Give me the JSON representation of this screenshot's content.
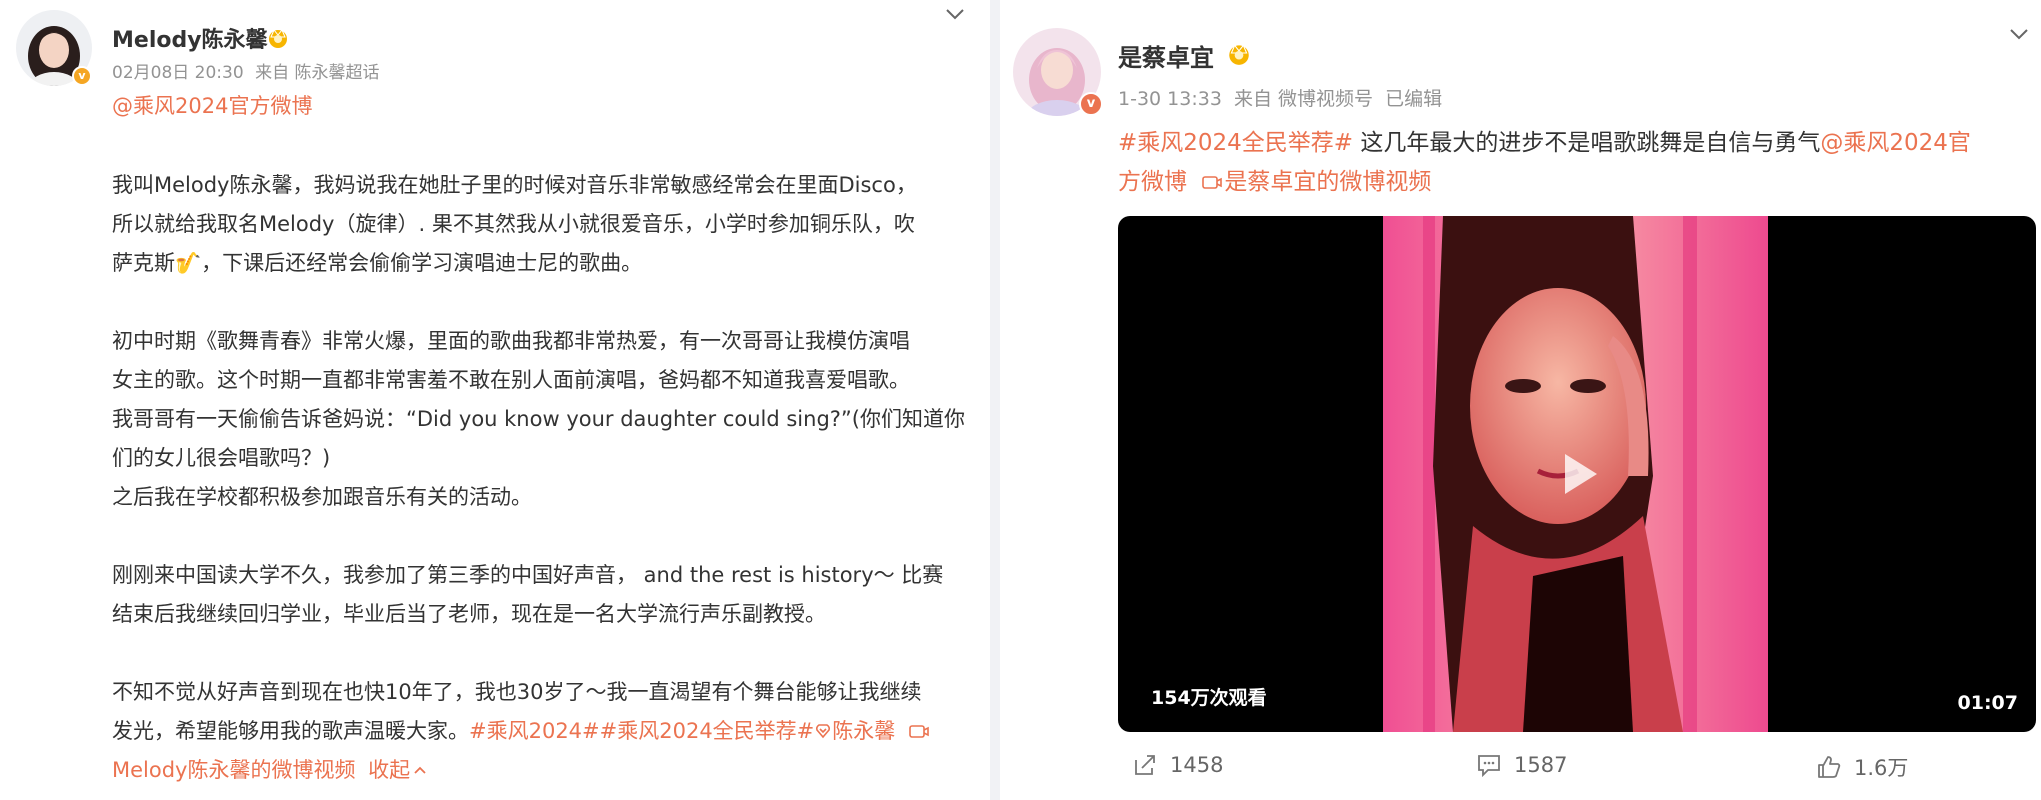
{
  "left_post": {
    "username": "Melody陈永馨",
    "timestamp": "02月08日 20:30",
    "source": "来自 陈永馨超话",
    "mention_line": "@乘风2024官方微博",
    "paragraphs": [
      [
        "我叫Melody陈永馨，我妈说我在她肚子里的时候对音乐非常敏感经常会在里面Disco，",
        "所以就给我取名Melody（旋律）. 果不其然我从小就很爱音乐，小学时参加铜乐队，吹",
        "萨克斯🎷，下课后还经常会偷偷学习演唱迪士尼的歌曲。"
      ],
      [
        "初中时期《歌舞青春》非常火爆，里面的歌曲我都非常热爱，有一次哥哥让我模仿演唱",
        "女主的歌。这个时期一直都非常害羞不敢在别人面前演唱，爸妈都不知道我喜爱唱歌。",
        "我哥哥有一天偷偷告诉爸妈说：“Did you know your daughter could sing?”(你们知道你",
        "们的女儿很会唱歌吗？)",
        "之后我在学校都积极参加跟音乐有关的活动。"
      ],
      [
        "刚刚来中国读大学不久，我参加了第三季的中国好声音， and the rest is history～ 比赛",
        "结束后我继续回归学业，毕业后当了老师，现在是一名大学流行声乐副教授。"
      ]
    ],
    "last_line_1": "不知不觉从好声音到现在也快10年了，我也30岁了～我一直渴望有个舞台能够让我继续",
    "last_line_2_plain": "发光，希望能够用我的歌声温暖大家。",
    "hashtags": "#乘风2024##乘风2024全民举荐#",
    "super_topic": "陈永馨",
    "video_link": "Melody陈永馨的微博视频",
    "collapse_label": "收起"
  },
  "right_post": {
    "username": "是蔡卓宜",
    "timestamp": "1-30 13:33",
    "source": "来自 微博视频号",
    "edited": "已编辑",
    "hashtag": "#乘风2024全民举荐#",
    "text": " 这几年最大的进步不是唱歌跳舞是自信与勇气",
    "mention_part1": "@乘风2024官",
    "mention_part2": "方微博",
    "video_link": "是蔡卓宜的微博视频",
    "video": {
      "views": "154万次观看",
      "duration": "01:07"
    },
    "actions": {
      "repost_count": "1458",
      "comment_count": "1587",
      "like_count": "1.6万"
    }
  },
  "colors": {
    "accent": "#eb7350",
    "verified": "#f5a623",
    "meta": "#939393"
  }
}
